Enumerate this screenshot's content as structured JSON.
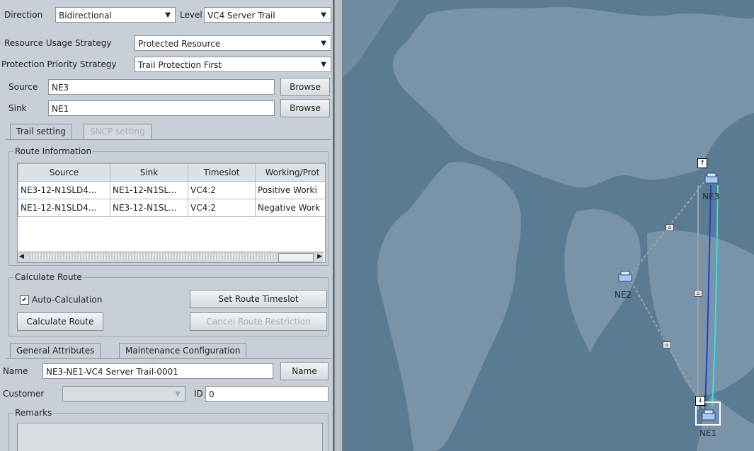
{
  "top": {
    "direction_label": "Direction",
    "direction_value": "Bidirectional",
    "level_label": "Level",
    "level_value": "VC4 Server Trail",
    "resource_label": "Resource Usage Strategy",
    "resource_value": "Protected Resource",
    "priority_label": "Protection Priority Strategy",
    "priority_value": "Trail Protection First",
    "source_label": "Source",
    "source_value": "NE3",
    "sink_label": "Sink",
    "sink_value": "NE1",
    "browse_label": "Browse"
  },
  "tabs": {
    "trail_setting": "Trail setting",
    "sncp_setting": "SNCP setting"
  },
  "route_info": {
    "title": "Route Information",
    "columns": [
      "Source",
      "Sink",
      "Timeslot",
      "Working/Prot"
    ],
    "rows": [
      [
        "NE3-12-N1SLD4...",
        "NE1-12-N1SL...",
        "VC4:2",
        "Positive Worki"
      ],
      [
        "NE1-12-N1SLD4...",
        "NE3-12-N1SL...",
        "VC4:2",
        "Negative Work"
      ]
    ]
  },
  "calc": {
    "title": "Calculate Route",
    "auto_label": "Auto-Calculation",
    "auto_checked": true,
    "set_timeslot": "Set Route Timeslot",
    "calculate": "Calculate Route",
    "cancel_restriction": "Cancel Route Restriction"
  },
  "bottom_tabs": {
    "general": "General Attributes",
    "maintenance": "Maintenance Configuration"
  },
  "general": {
    "name_label": "Name",
    "name_value": "NE3-NE1-VC4 Server Trail-0001",
    "name_button": "Name",
    "customer_label": "Customer",
    "customer_value": "",
    "id_label": "ID",
    "id_value": "0",
    "remarks_label": "Remarks"
  },
  "map": {
    "nodes": [
      "NE3",
      "NE2",
      "NE1"
    ],
    "colors": {
      "background": "#5b7b93",
      "land": "#7f98ab",
      "working": "#1f3fd1",
      "protect": "#35e0e0"
    },
    "icons": [
      "ne-icon",
      "arrow-up-icon",
      "arrow-down-icon",
      "link-label-icon"
    ]
  }
}
